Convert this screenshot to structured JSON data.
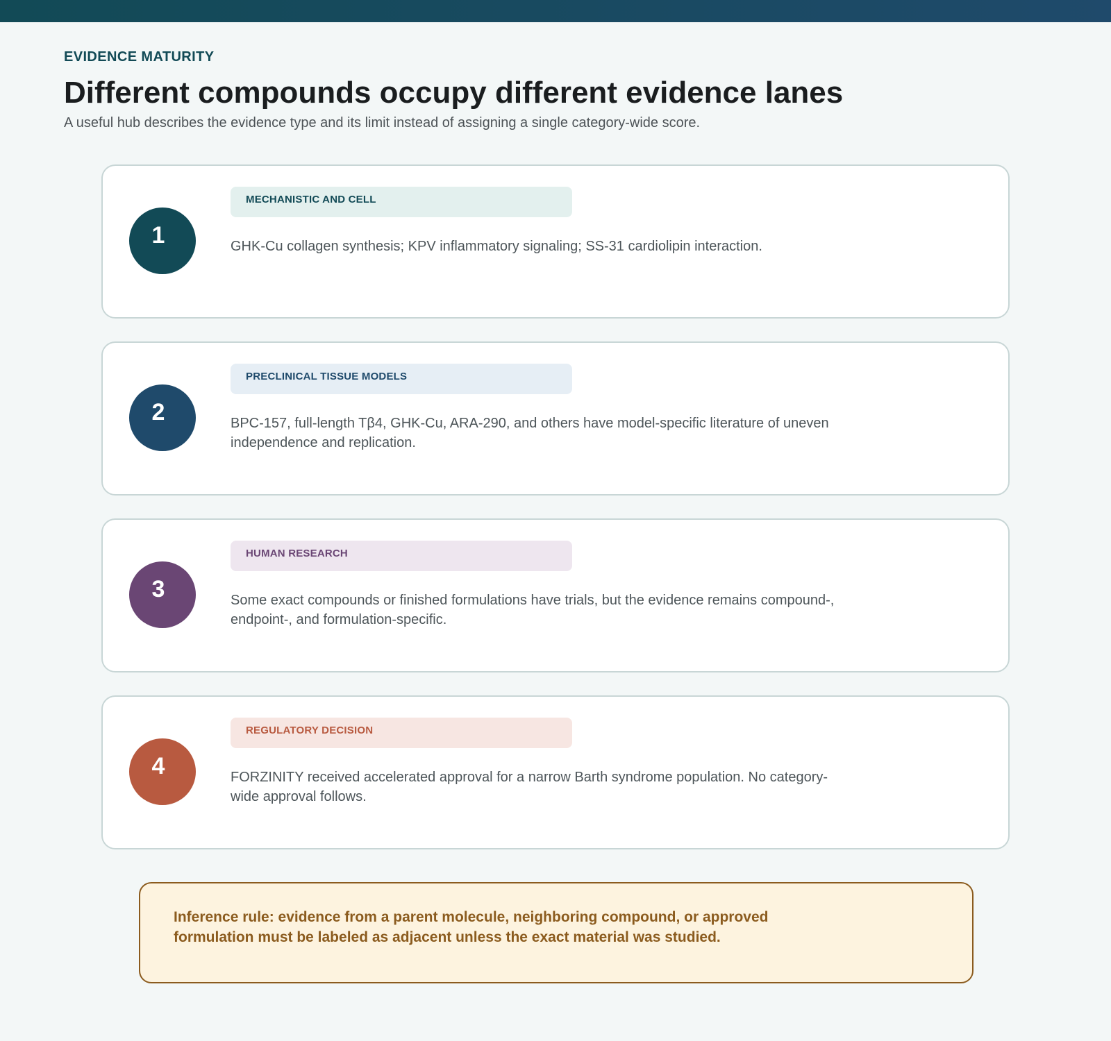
{
  "header": {
    "eyebrow": "EVIDENCE MATURITY",
    "title": "Different compounds occupy different evidence lanes",
    "subtitle": "A useful hub describes the evidence type and its limit instead of assigning a single category-wide score."
  },
  "lanes": [
    {
      "number": "1",
      "label": "MECHANISTIC AND CELL",
      "text": "GHK-Cu collagen synthesis; KPV inflammatory signaling; SS-31 cardiolipin interaction.",
      "color": "#124a56",
      "pill_bg": "#e3f0ee",
      "pill_text": "#124a56"
    },
    {
      "number": "2",
      "label": "PRECLINICAL TISSUE MODELS",
      "text": "BPC-157, full-length Tβ4, GHK-Cu, ARA-290, and others have model-specific literature of uneven independence and replication.",
      "color": "#1f4a6b",
      "pill_bg": "#e6eef5",
      "pill_text": "#1f4a6b"
    },
    {
      "number": "3",
      "label": "HUMAN RESEARCH",
      "text": "Some exact compounds or finished formulations have trials, but the evidence remains compound-, endpoint-, and formulation-specific.",
      "color": "#6a4674",
      "pill_bg": "#eee6ef",
      "pill_text": "#6a4674"
    },
    {
      "number": "4",
      "label": "REGULATORY DECISION",
      "text": "FORZINITY received accelerated approval for a narrow Barth syndrome population. No category-wide approval follows.",
      "color": "#b85a40",
      "pill_bg": "#f7e6e2",
      "pill_text": "#b85a40"
    }
  ],
  "rule": {
    "text": "Inference rule: evidence from a parent molecule, neighboring compound, or approved formulation must be labeled as adjacent unless the exact material was studied."
  },
  "colors": {
    "topbar_left": "#124a56",
    "topbar_right": "#1f4a6b",
    "eyebrow": "#124a56",
    "rule_border": "#8b5b1e",
    "rule_bg": "#fdf3df"
  }
}
